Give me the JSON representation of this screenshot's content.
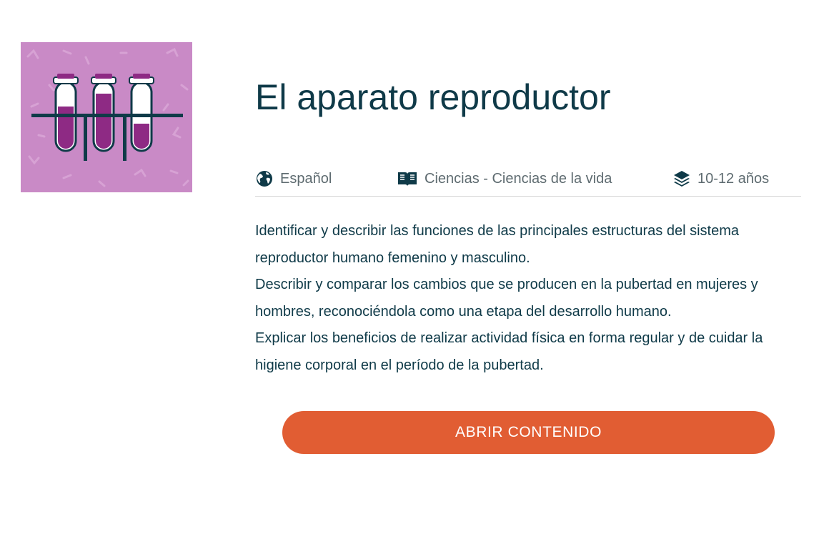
{
  "resource": {
    "title": "El aparato reproductor",
    "thumbnail_icon": "test-tubes-icon",
    "thumbnail_bg": "#c98ac6"
  },
  "meta": {
    "language": {
      "icon": "globe-icon",
      "label": "Español"
    },
    "subject": {
      "icon": "book-icon",
      "label": "Ciencias - Ciencias de la vida"
    },
    "age": {
      "icon": "layers-icon",
      "label": "10-12 años"
    }
  },
  "description": [
    "Identificar y describir las funciones de las principales estructuras del sistema reproductor humano femenino y masculino.",
    "Describir y comparar los cambios que se producen en la pubertad en mujeres y hombres, reconociéndola como una etapa del desarrollo humano.",
    "Explicar los beneficios de realizar actividad física en forma regular y de cuidar la higiene corporal en el período de la pubertad."
  ],
  "cta": {
    "label": "ABRIR CONTENIDO",
    "color": "#e15d33"
  },
  "colors": {
    "title": "#0f3a48",
    "meta": "#5e6b70",
    "tube_fill": "#8e2a84"
  }
}
